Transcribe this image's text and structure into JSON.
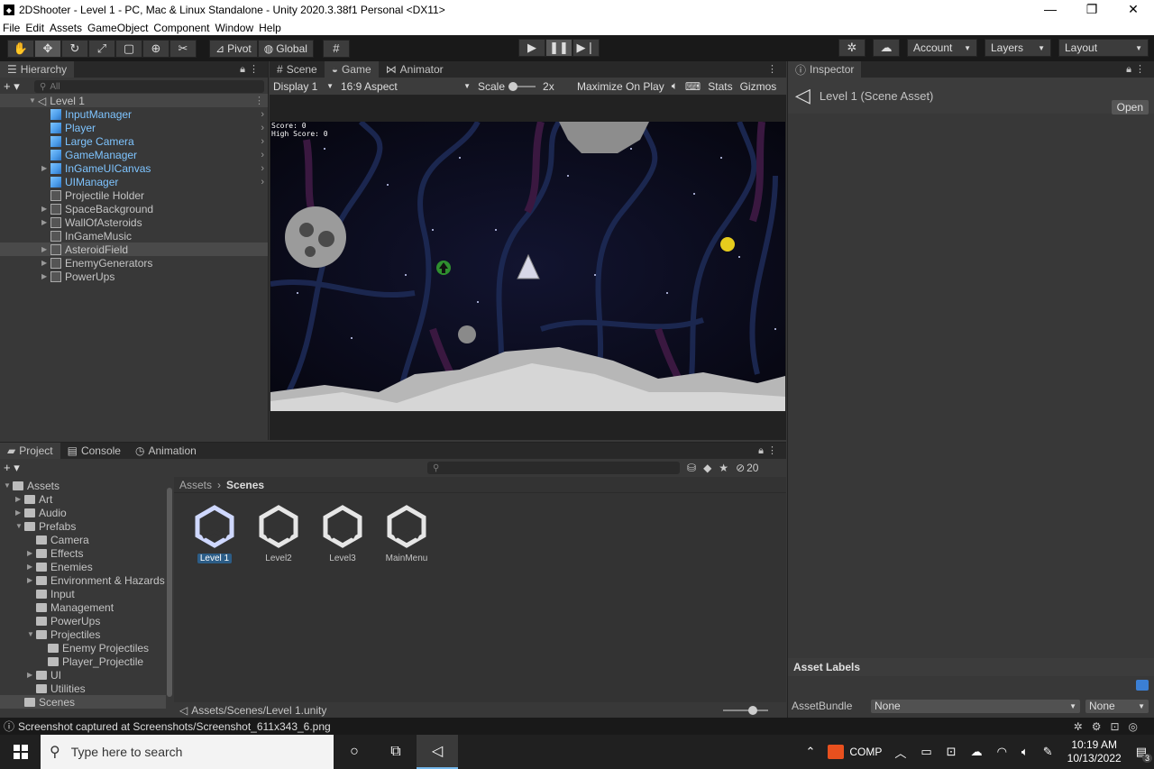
{
  "window": {
    "title": "2DShooter - Level 1 - PC, Mac & Linux Standalone - Unity 2020.3.38f1 Personal <DX11>"
  },
  "menu": [
    "File",
    "Edit",
    "Assets",
    "GameObject",
    "Component",
    "Window",
    "Help"
  ],
  "toolbar": {
    "pivot_label": "Pivot",
    "global_label": "Global",
    "account_label": "Account",
    "layers_label": "Layers",
    "layout_label": "Layout"
  },
  "hierarchy": {
    "tab_label": "Hierarchy",
    "search_placeholder": "All",
    "scene_name": "Level 1",
    "items": [
      {
        "label": "InputManager",
        "prefab": true,
        "expandable": false
      },
      {
        "label": "Player",
        "prefab": true,
        "expandable": false
      },
      {
        "label": "Large Camera",
        "prefab": true,
        "expandable": false
      },
      {
        "label": "GameManager",
        "prefab": true,
        "expandable": false
      },
      {
        "label": "InGameUICanvas",
        "prefab": true,
        "expandable": true
      },
      {
        "label": "UIManager",
        "prefab": true,
        "expandable": false
      },
      {
        "label": "Projectile Holder",
        "prefab": false,
        "expandable": false
      },
      {
        "label": "SpaceBackground",
        "prefab": false,
        "expandable": true
      },
      {
        "label": "WallOfAsteroids",
        "prefab": false,
        "expandable": true
      },
      {
        "label": "InGameMusic",
        "prefab": false,
        "expandable": false
      },
      {
        "label": "AsteroidField",
        "prefab": false,
        "expandable": true
      },
      {
        "label": "EnemyGenerators",
        "prefab": false,
        "expandable": true
      },
      {
        "label": "PowerUps",
        "prefab": false,
        "expandable": true
      }
    ]
  },
  "game_view": {
    "tabs": [
      "Scene",
      "Game",
      "Animator"
    ],
    "display": "Display 1",
    "aspect": "16:9 Aspect",
    "scale_label": "Scale",
    "scale_value": "2x",
    "maximize_label": "Maximize On Play",
    "stats_label": "Stats",
    "gizmos_label": "Gizmos",
    "score_text": "Score: 0",
    "high_score_text": "High Score: 0"
  },
  "inspector": {
    "tab_label": "Inspector",
    "asset_title": "Level 1 (Scene Asset)",
    "open_label": "Open",
    "asset_labels_title": "Asset Labels",
    "assetbundle_label": "AssetBundle",
    "assetbundle_value": "None",
    "variant_value": "None"
  },
  "project": {
    "tabs": [
      "Project",
      "Console",
      "Animation"
    ],
    "hidden_count": "20",
    "breadcrumb_root": "Assets",
    "breadcrumb_current": "Scenes",
    "path": "Assets/Scenes/Level 1.unity",
    "tree": [
      {
        "label": "Assets",
        "depth": 0,
        "arrow": "open"
      },
      {
        "label": "Art",
        "depth": 1,
        "arrow": "closed"
      },
      {
        "label": "Audio",
        "depth": 1,
        "arrow": "closed"
      },
      {
        "label": "Prefabs",
        "depth": 1,
        "arrow": "open"
      },
      {
        "label": "Camera",
        "depth": 2,
        "arrow": "none"
      },
      {
        "label": "Effects",
        "depth": 2,
        "arrow": "closed"
      },
      {
        "label": "Enemies",
        "depth": 2,
        "arrow": "closed"
      },
      {
        "label": "Environment & Hazards",
        "depth": 2,
        "arrow": "closed"
      },
      {
        "label": "Input",
        "depth": 2,
        "arrow": "none"
      },
      {
        "label": "Management",
        "depth": 2,
        "arrow": "none"
      },
      {
        "label": "PowerUps",
        "depth": 2,
        "arrow": "none"
      },
      {
        "label": "Projectiles",
        "depth": 2,
        "arrow": "open"
      },
      {
        "label": "Enemy Projectiles",
        "depth": 3,
        "arrow": "none"
      },
      {
        "label": "Player_Projectile",
        "depth": 3,
        "arrow": "none"
      },
      {
        "label": "UI",
        "depth": 2,
        "arrow": "closed"
      },
      {
        "label": "Utilities",
        "depth": 2,
        "arrow": "none"
      },
      {
        "label": "Scenes",
        "depth": 1,
        "arrow": "none"
      }
    ],
    "assets": [
      {
        "label": "Level 1",
        "selected": true
      },
      {
        "label": "Level2",
        "selected": false
      },
      {
        "label": "Level3",
        "selected": false
      },
      {
        "label": "MainMenu",
        "selected": false
      }
    ]
  },
  "status": {
    "message": "Screenshot captured at Screenshots/Screenshot_611x343_6.png"
  },
  "taskbar": {
    "search_placeholder": "Type here to search",
    "comp_label": "COMP",
    "time": "10:19 AM",
    "date": "10/13/2022",
    "notification_count": "3"
  }
}
